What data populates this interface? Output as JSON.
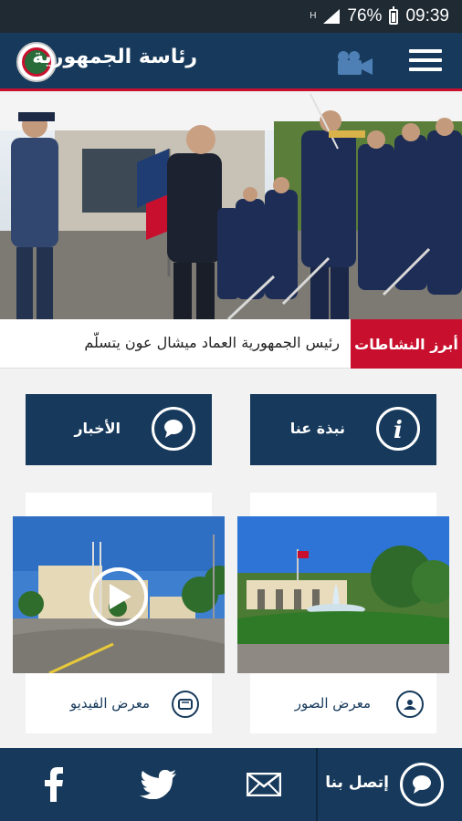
{
  "status_bar": {
    "sim": "H",
    "battery": "76%",
    "time": "09:39"
  },
  "app_bar": {
    "title": "رئاسة الجمهورية",
    "menu_icon": "hamburger-menu-icon",
    "video_icon": "video-camera-icon",
    "logo": "presidency-logo"
  },
  "ticker": {
    "label": "أبرز النشاطات",
    "headline": "رئيس الجمهورية العماد ميشال عون يتسلّم"
  },
  "tiles": {
    "about": {
      "label": "نبذة عنا",
      "icon": "info-icon"
    },
    "news": {
      "label": "الأخبار",
      "icon": "speech-bubble-icon"
    }
  },
  "galleries": {
    "photos": {
      "label": "معرض الصور",
      "icon": "photo-icon"
    },
    "videos": {
      "label": "معرض الفيديو",
      "icon": "video-icon"
    }
  },
  "footer": {
    "contact_label": "إتصل بنا",
    "contact_icon": "chat-bubble-icon",
    "social": [
      "email-icon",
      "twitter-icon",
      "facebook-icon"
    ]
  },
  "colors": {
    "primary": "#173a5c",
    "accent": "#c8102e",
    "status_bar": "#1f2a33"
  }
}
